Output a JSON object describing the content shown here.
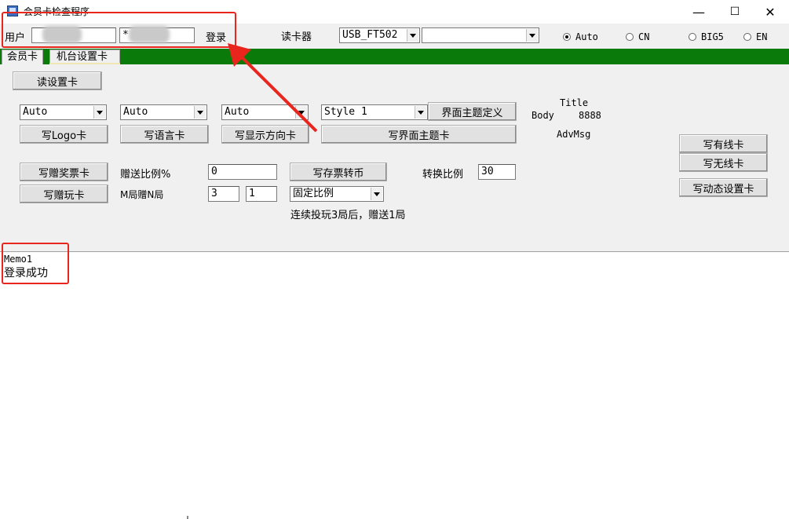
{
  "window": {
    "title": "会员卡检查程序",
    "min": "—",
    "max": "☐",
    "close": "✕"
  },
  "toolbar": {
    "user_label": "用户",
    "user_value": "",
    "password_value": "*",
    "login_label": "登录",
    "reader_label": "读卡器",
    "reader_value": "USB_FT502",
    "port_value": "",
    "encodings": [
      {
        "label": "Auto",
        "selected": true
      },
      {
        "label": "CN",
        "selected": false
      },
      {
        "label": "BIG5",
        "selected": false
      },
      {
        "label": "EN",
        "selected": false
      }
    ]
  },
  "tabs": [
    "会员卡",
    "机台设置卡"
  ],
  "panel": {
    "read_settings_button": "读设置卡",
    "combo_1": "Auto",
    "combo_2": "Auto",
    "combo_3": "Auto",
    "style_combo": "Style 1",
    "theme_define_button": "界面主题定义",
    "preview": {
      "title": "Title",
      "body": "Body",
      "body_value": "8888",
      "adv": "AdvMsg"
    },
    "write_logo_button": "写Logo卡",
    "write_language_button": "写语言卡",
    "write_orientation_button": "写显示方向卡",
    "write_theme_button": "写界面主题卡",
    "write_prize_ticket_button": "写赠奖票卡",
    "gift_ratio_label": "赠送比例%",
    "gift_ratio_value": "0",
    "write_ticket_coin_button": "写存票转币",
    "convert_ratio_label": "转换比例",
    "convert_ratio_value": "30",
    "write_gift_play_button": "写赠玩卡",
    "m_n_label": "M局赠N局",
    "m_value": "3",
    "n_value": "1",
    "fixed_ratio_combo": "固定比例",
    "continuous_note": "连续投玩3局后，赠送1局",
    "write_wired_button": "写有线卡",
    "write_wireless_button": "写无线卡",
    "write_dynamic_button": "写动态设置卡"
  },
  "memo": {
    "line1": "Memo1",
    "line2": "登录成功"
  },
  "colors": {
    "annotation": "#e8261e",
    "tab_band": "#0a7a0a"
  }
}
